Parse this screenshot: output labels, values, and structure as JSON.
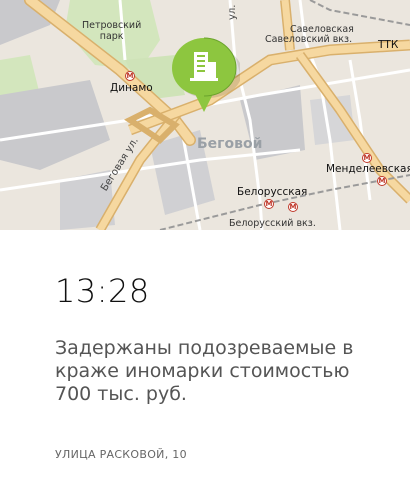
{
  "map": {
    "labels": {
      "petrovsky_park": "Петровский\nпарк",
      "dinamo": "Динамо",
      "begovoy": "Беговой",
      "begovaya_ul": "Беговая ул.",
      "belorusskaya": "Белорусская",
      "belorussky_vkz": "Белорусский вкз.",
      "savelovskaya": "Савеловская",
      "savelovsky_vkz": "Савеловский вкз.",
      "ttk": "ТТК",
      "mendeleevskaya": "Менделеевская",
      "ul_fragment": "ул."
    },
    "pin_icon": "building-icon",
    "colors": {
      "pin_green": "#8dc63f",
      "pin_green_dark": "#6aa32c",
      "road_main": "#f6d8a0",
      "road_edge": "#d9b06c",
      "park": "#cfe3b8",
      "block_gray": "#c9c9cc"
    }
  },
  "event": {
    "time": "13:28",
    "headline": "Задержаны подозреваемые в краже иномарки стоимостью 700 тыс. руб.",
    "address": "УЛИЦА РАСКОВОЙ, 10"
  }
}
